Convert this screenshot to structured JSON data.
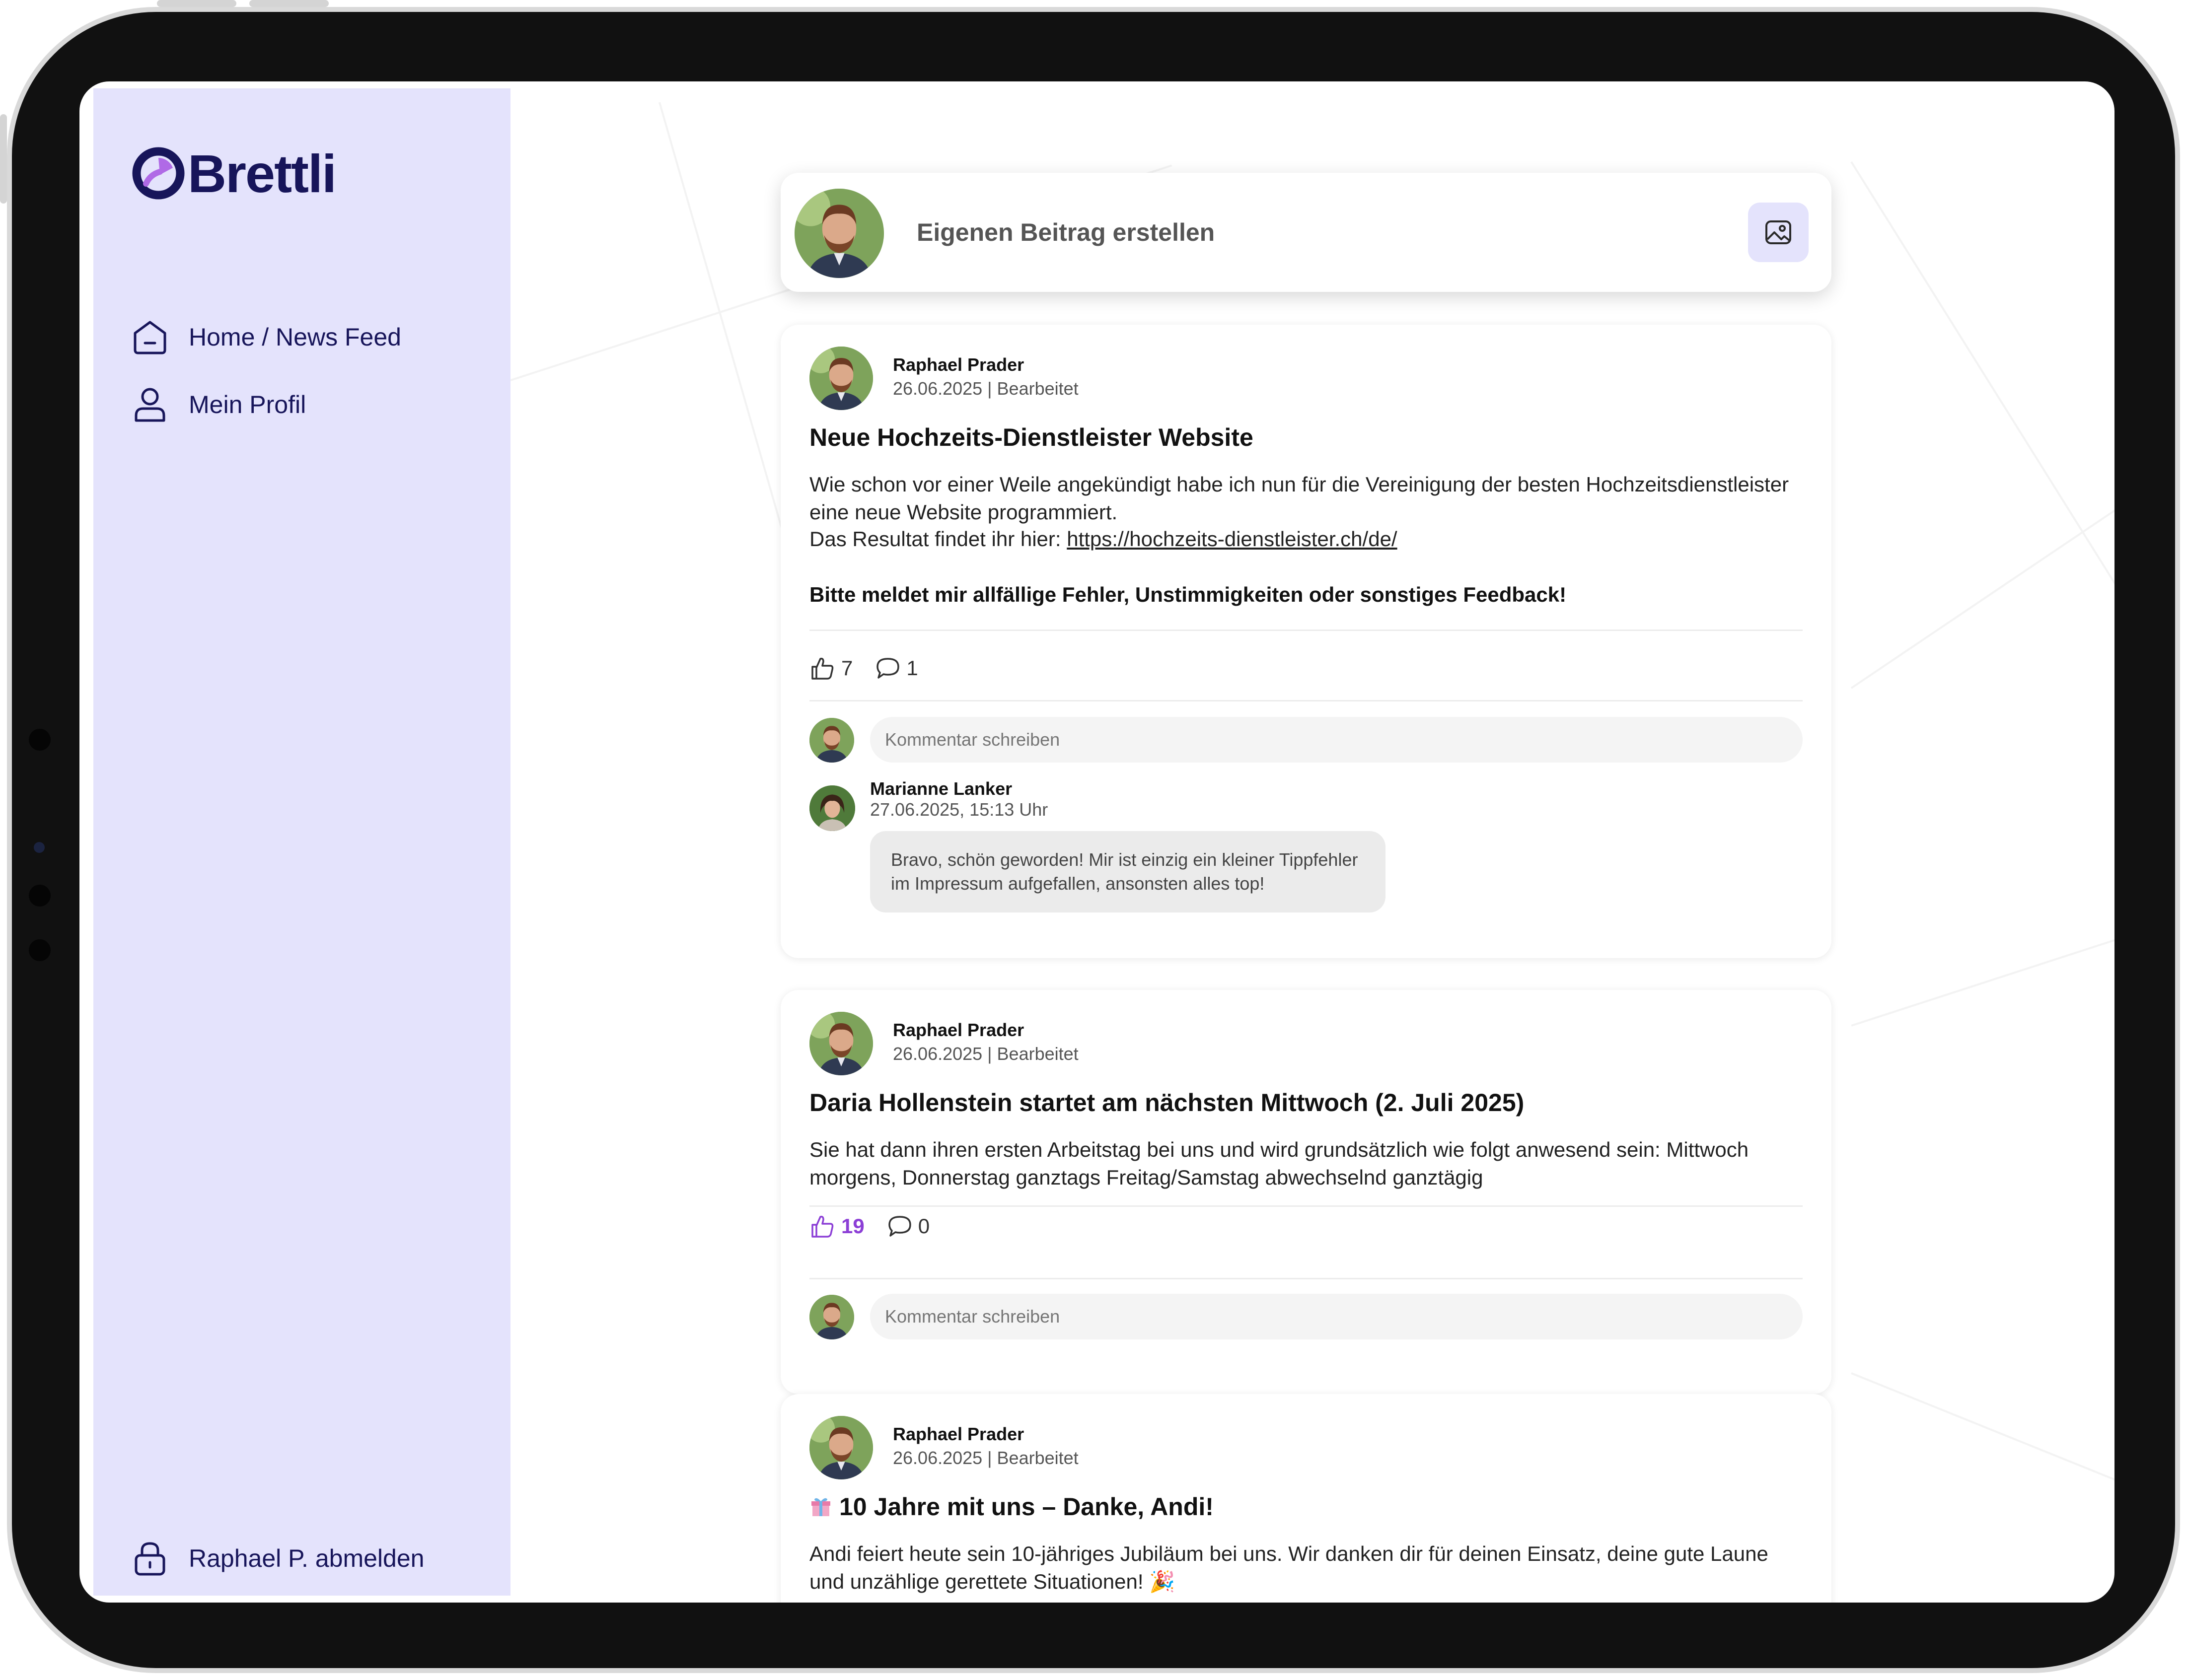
{
  "app": {
    "name": "Brettli"
  },
  "sidebar": {
    "items": [
      {
        "label": "Home / News Feed",
        "icon": "home-icon"
      },
      {
        "label": "Mein Profil",
        "icon": "user-icon"
      }
    ],
    "logout_label": "Raphael P. abmelden"
  },
  "composer": {
    "placeholder": "Eigenen Beitrag erstellen",
    "media_icon": "image-icon"
  },
  "posts": [
    {
      "author": "Raphael Prader",
      "meta": "26.06.2025 | Bearbeitet",
      "title": "Neue Hochzeits-Dienstleister Website",
      "body": "Wie schon vor einer Weile angekündigt habe ich nun für die Vereinigung der besten Hochzeitsdienstleister eine neue Website programmiert.",
      "link_prefix": "Das Resultat findet ihr hier: ",
      "link": "https://hochzeits-dienstleister.ch/de/",
      "bold": "Bitte meldet mir allfällige Fehler, Unstimmigkeiten oder sonstiges Feedback!",
      "likes": "7",
      "comments": "1",
      "liked": false,
      "comment_placeholder": "Kommentar schreiben",
      "replies": [
        {
          "author": "Marianne Lanker",
          "time": "27.06.2025, 15:13 Uhr",
          "text": "Bravo, schön geworden! Mir ist einzig ein kleiner Tippfehler im Impressum aufgefallen, ansonsten alles top!"
        }
      ]
    },
    {
      "author": "Raphael Prader",
      "meta": "26.06.2025 | Bearbeitet",
      "title": "Daria Hollenstein startet am nächsten Mittwoch (2. Juli 2025)",
      "body": "Sie hat dann ihren ersten Arbeitstag bei uns und wird grundsätzlich wie folgt anwesend sein: Mittwoch morgens, Donnerstag ganztags Freitag/Samstag abwechselnd ganztägig",
      "likes": "19",
      "comments": "0",
      "liked": true,
      "comment_placeholder": "Kommentar schreiben"
    },
    {
      "author": "Raphael Prader",
      "meta": "26.06.2025 | Bearbeitet",
      "title": "10 Jahre mit uns – Danke, Andi!",
      "body": "Andi feiert heute sein 10-jähriges Jubiläum bei uns. Wir danken dir für deinen Einsatz, deine gute Laune und unzählige gerettete Situationen! 🎉"
    }
  ],
  "colors": {
    "sidebar_bg": "#e4e3fc",
    "brand": "#17155a",
    "accent": "#8c3fd6"
  }
}
